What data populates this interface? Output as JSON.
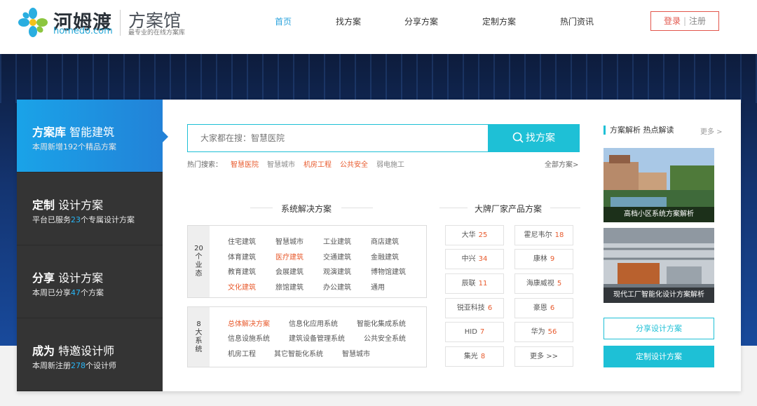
{
  "header": {
    "logo_cn": "河姆渡",
    "logo_en": "homedo.com",
    "site_title": "方案馆",
    "site_subtitle": "最专业的在线方案库",
    "nav": [
      "首页",
      "找方案",
      "分享方案",
      "定制方案",
      "热门资讯"
    ],
    "login": "登录",
    "register": "注册"
  },
  "left_menu": [
    {
      "bold": "方案库",
      "normal": "智能建筑",
      "desc_pre": "本周新增192个精品方案",
      "num": "",
      "desc_post": ""
    },
    {
      "bold": "定制",
      "normal": "设计方案",
      "desc_pre": "平台已服务",
      "num": "23",
      "desc_post": "个专属设计方案"
    },
    {
      "bold": "分享",
      "normal": "设计方案",
      "desc_pre": "本周已分享",
      "num": "47",
      "desc_post": "个方案"
    },
    {
      "bold": "成为",
      "normal": "特邀设计师",
      "desc_pre": "本周新注册",
      "num": "278",
      "desc_post": "个设计师"
    }
  ],
  "search": {
    "placeholder": "大家都在搜：智慧医院",
    "button": "找方案",
    "hot_label": "热门搜索：",
    "hot_tags": [
      "智慧医院",
      "智慧城市",
      "机房工程",
      "公共安全",
      "弱电施工"
    ],
    "all_link": "全部方案>"
  },
  "solutions": {
    "title": "系统解决方案",
    "group1_label": [
      "20",
      "个",
      "业",
      "态"
    ],
    "group1": [
      "住宅建筑",
      "智慧城市",
      "工业建筑",
      "商店建筑",
      "体育建筑",
      "医疗建筑",
      "交通建筑",
      "金融建筑",
      "教育建筑",
      "会展建筑",
      "观演建筑",
      "博物馆建筑",
      "文化建筑",
      "旅馆建筑",
      "办公建筑",
      "通用"
    ],
    "group2_label": [
      "8",
      "大",
      "系",
      "统"
    ],
    "group2": [
      "总体解决方案",
      "信息化应用系统",
      "智能化集成系统",
      "信息设施系统",
      "建筑设备管理系统",
      "公共安全系统",
      "机房工程",
      "其它智能化系统",
      "智慧城市"
    ]
  },
  "brands": {
    "title": "大牌厂家产品方案",
    "items": [
      {
        "name": "大华",
        "count": "25"
      },
      {
        "name": "霍尼韦尔",
        "count": "18"
      },
      {
        "name": "中兴",
        "count": "34"
      },
      {
        "name": "康林",
        "count": "9"
      },
      {
        "name": "辰联",
        "count": "11"
      },
      {
        "name": "海康威视",
        "count": "5"
      },
      {
        "name": "锐亚科技",
        "count": "6"
      },
      {
        "name": "豪恩",
        "count": "6"
      },
      {
        "name": "HID",
        "count": "7"
      },
      {
        "name": "华为",
        "count": "56"
      },
      {
        "name": "集光",
        "count": "8"
      },
      {
        "name": "更多 >>",
        "count": ""
      }
    ]
  },
  "right_panel": {
    "title": "方案解析 热点解读",
    "more": "更多 >",
    "articles": [
      "高档小区系统方案解析",
      "现代工厂智能化设计方案解析"
    ],
    "share_button": "分享设计方案",
    "custom_button": "定制设计方案"
  },
  "colors": {
    "accent": "#1ec0d6",
    "orange": "#e85b2e",
    "blue": "#2282d8",
    "dark": "#343434"
  }
}
